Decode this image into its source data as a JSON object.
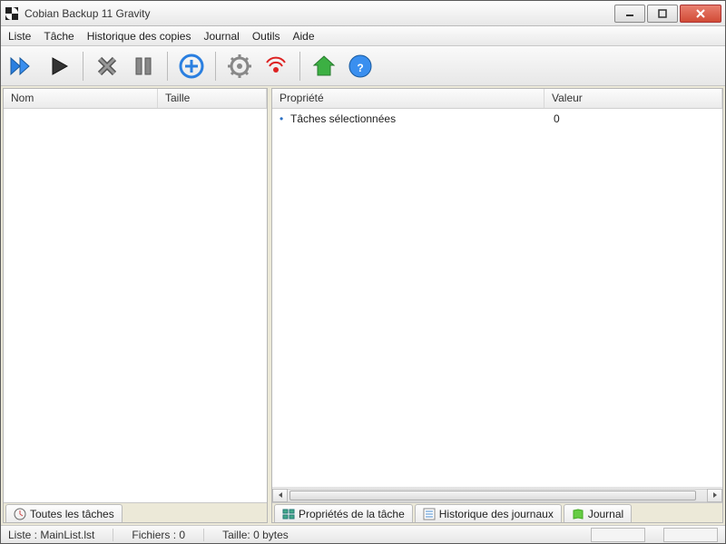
{
  "window": {
    "title": "Cobian Backup 11 Gravity"
  },
  "menu": [
    "Liste",
    "Tâche",
    "Historique des copies",
    "Journal",
    "Outils",
    "Aide"
  ],
  "toolbar": {
    "buttons": [
      "run-all",
      "run-selected",
      "abort",
      "pause",
      "new-task",
      "options",
      "remote",
      "home",
      "help"
    ]
  },
  "left_panel": {
    "columns": [
      "Nom",
      "Taille"
    ],
    "rows": [],
    "tabs": [
      "Toutes les tâches"
    ]
  },
  "right_panel": {
    "columns": [
      "Propriété",
      "Valeur"
    ],
    "rows": [
      {
        "property": "Tâches sélectionnées",
        "value": "0"
      }
    ],
    "tabs": [
      "Propriétés de la tâche",
      "Historique des journaux",
      "Journal"
    ]
  },
  "status": {
    "list": "Liste : MainList.lst",
    "files": "Fichiers : 0",
    "size": "Taille: 0 bytes"
  }
}
